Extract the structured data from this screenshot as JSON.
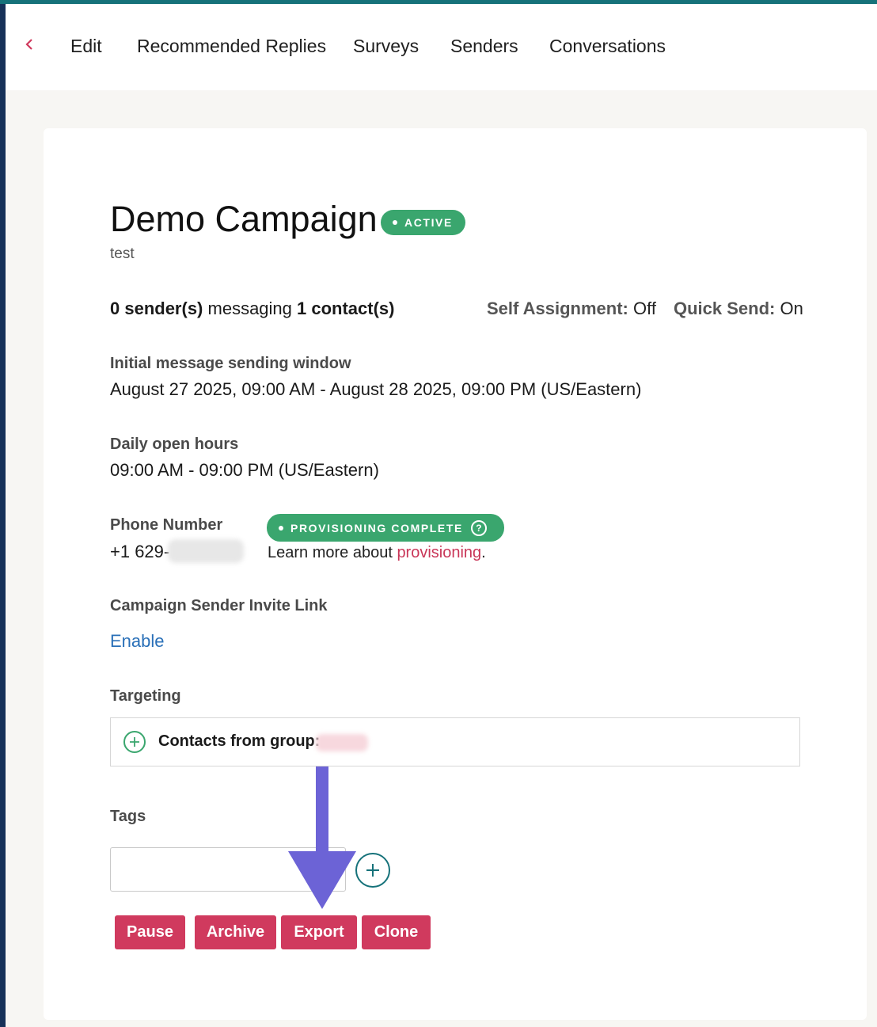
{
  "nav": {
    "back_icon": "chevron-left-icon",
    "items": [
      "Edit",
      "Recommended Replies",
      "Surveys",
      "Senders",
      "Conversations"
    ]
  },
  "campaign": {
    "title": "Demo Campaign",
    "status_badge": "ACTIVE",
    "description": "test"
  },
  "summary": {
    "senders_count": "0 sender(s)",
    "messaging_text": " messaging ",
    "contacts_count": "1 contact(s)",
    "self_assignment_label": "Self Assignment:",
    "self_assignment_value": " Off",
    "quick_send_label": "Quick Send:",
    "quick_send_value": " On"
  },
  "sending_window": {
    "label": "Initial message sending window",
    "value": "August 27 2025, 09:00 AM - August 28 2025, 09:00 PM (US/Eastern)"
  },
  "open_hours": {
    "label": "Daily open hours",
    "value": "09:00 AM - 09:00 PM (US/Eastern)"
  },
  "phone": {
    "label": "Phone Number",
    "value_prefix": "+1 629-",
    "provisioning_badge": "PROVISIONING COMPLETE",
    "learn_more_text": "Learn more about ",
    "learn_more_link": "provisioning",
    "learn_more_suffix": "."
  },
  "invite_link": {
    "label": "Campaign Sender Invite Link",
    "enable_link": "Enable"
  },
  "targeting": {
    "label": "Targeting",
    "group_text": "Contacts from group:"
  },
  "tags": {
    "label": "Tags",
    "input_value": ""
  },
  "actions": [
    "Pause",
    "Archive",
    "Export",
    "Clone"
  ],
  "colors": {
    "accent_green": "#3aa66e",
    "action_red": "#d03a5e",
    "link_blue": "#2a70b8",
    "annotation_arrow": "#6c63d6"
  }
}
